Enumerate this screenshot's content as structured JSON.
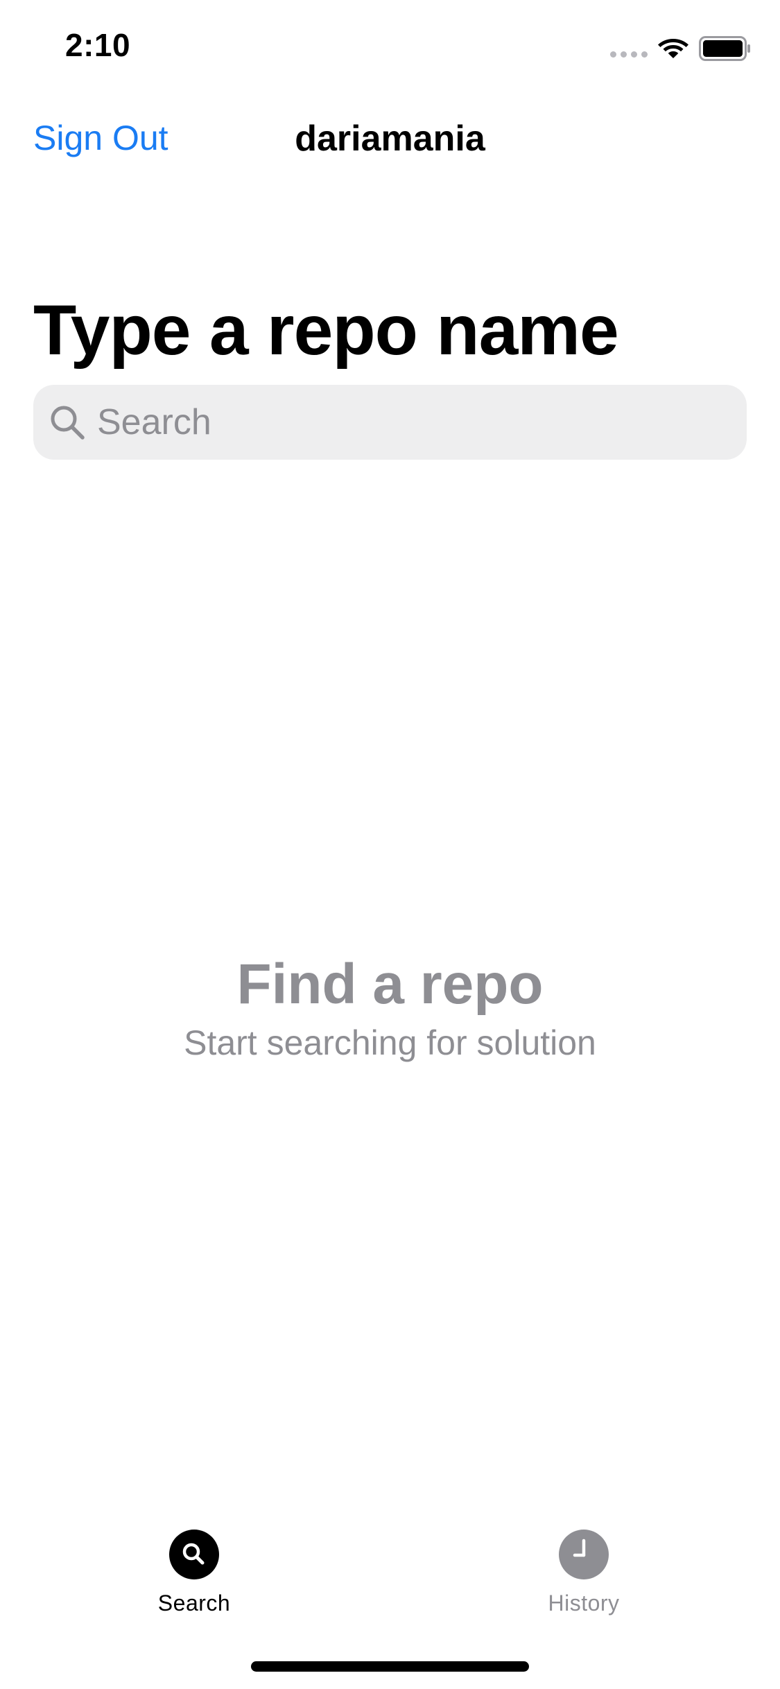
{
  "status_bar": {
    "time": "2:10",
    "icons": [
      "signal-dots-icon",
      "wifi-icon",
      "battery-icon"
    ]
  },
  "nav": {
    "left_button": "Sign Out",
    "title": "dariamania"
  },
  "main": {
    "large_title": "Type a repo name",
    "search": {
      "placeholder": "Search",
      "value": "",
      "icon": "search-icon"
    },
    "empty_state": {
      "title": "Find a repo",
      "subtitle": "Start searching for solution"
    }
  },
  "tab_bar": {
    "tabs": [
      {
        "label": "Search",
        "icon": "search-icon",
        "selected": true
      },
      {
        "label": "History",
        "icon": "clock-icon",
        "selected": false
      }
    ]
  },
  "colors": {
    "accent": "#1a7cf3",
    "secondary_text": "#8e8e93",
    "search_field_bg": "#eeeeef",
    "selected_tab": "#000000",
    "unselected_tab": "#8e8e93"
  }
}
